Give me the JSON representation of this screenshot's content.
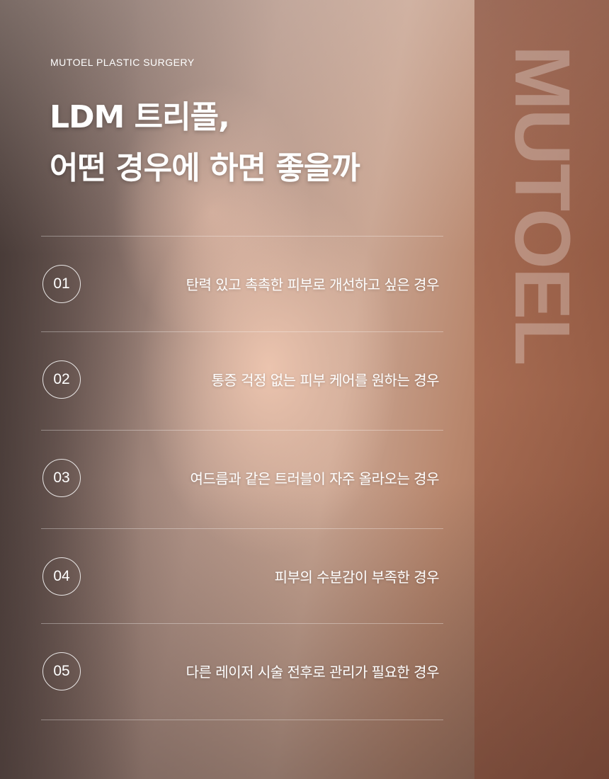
{
  "brand": "MUTOEL PLASTIC SURGERY",
  "side_logo": "MUTOEL",
  "title": {
    "line1": "LDM 트리플,",
    "line2": "어떤 경우에 하면 좋을까"
  },
  "items": [
    {
      "number": "01",
      "text": "탄력 있고 촉촉한 피부로 개선하고 싶은 경우"
    },
    {
      "number": "02",
      "text": "통증 걱정 없는 피부 케어를 원하는 경우"
    },
    {
      "number": "03",
      "text": "여드름과 같은 트러블이 자주 올라오는 경우"
    },
    {
      "number": "04",
      "text": "피부의 수분감이 부족한 경우"
    },
    {
      "number": "05",
      "text": "다른 레이저 시술 전후로 관리가 필요한 경우"
    }
  ],
  "colors": {
    "text": "#ffffff",
    "side_band": "#8a4a34"
  }
}
